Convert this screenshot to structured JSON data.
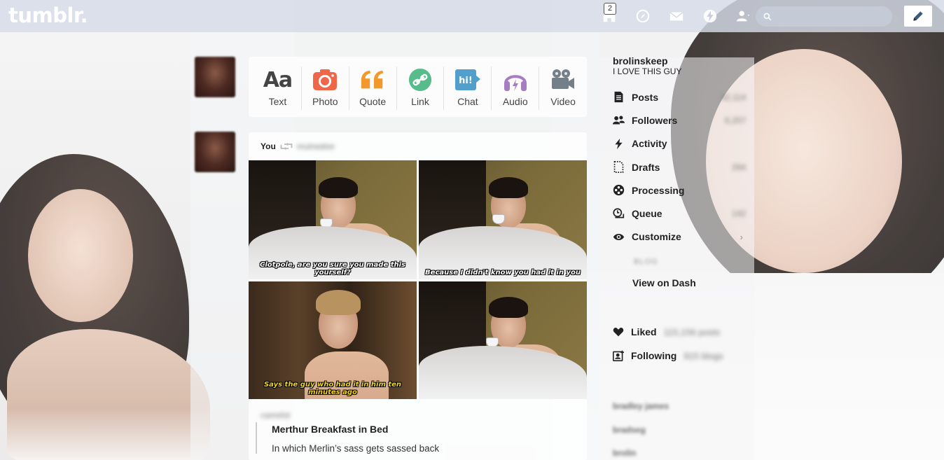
{
  "topbar": {
    "logo": "tumblr.",
    "inbox_badge": "2",
    "search_placeholder": "",
    "icons": [
      "home-icon",
      "compass-icon",
      "mail-icon",
      "lightning-icon",
      "account-icon",
      "search-icon",
      "pencil-icon"
    ]
  },
  "post_types": [
    {
      "label": "Text",
      "icon": "text-icon",
      "color": "#444444"
    },
    {
      "label": "Photo",
      "icon": "camera-icon",
      "color": "#f06649"
    },
    {
      "label": "Quote",
      "icon": "quote-icon",
      "color": "#f2992e"
    },
    {
      "label": "Link",
      "icon": "link-icon",
      "color": "#56bc8a"
    },
    {
      "label": "Chat",
      "icon": "chat-icon",
      "color": "#529ecc"
    },
    {
      "label": "Audio",
      "icon": "headphones-icon",
      "color": "#a77dc2"
    },
    {
      "label": "Video",
      "icon": "video-icon",
      "color": "#748089"
    }
  ],
  "post": {
    "you_label": "You",
    "reblogged_from": "muirwalse",
    "captions": [
      "Clotpole, are you sure you made this yourself?",
      "Because I didn't know you had it in you",
      "Says the guy who had it in him ten minutes ago",
      ""
    ],
    "source_name": "camelot",
    "title": "Merthur Breakfast in Bed",
    "description": "In which Merlin’s sass gets sassed back"
  },
  "sidebar": {
    "blog_name": "brolinskeep",
    "blog_description": "I LOVE THIS GUY",
    "menu": [
      {
        "label": "Posts",
        "icon": "document-icon",
        "count": "42,114"
      },
      {
        "label": "Followers",
        "icon": "people-icon",
        "count": "6,207"
      },
      {
        "label": "Activity",
        "icon": "lightning-icon",
        "count": ""
      },
      {
        "label": "Drafts",
        "icon": "drafts-icon",
        "count": "294"
      },
      {
        "label": "Processing",
        "icon": "processing-icon",
        "count": ""
      },
      {
        "label": "Queue",
        "icon": "queue-icon",
        "count": "142"
      },
      {
        "label": "Customize",
        "icon": "eye-icon",
        "count": ""
      }
    ],
    "blog_label": "BLOG",
    "view_on_dash": "View on Dash",
    "liked_label": "Liked",
    "liked_count": "115,156 posts",
    "following_label": "Following",
    "following_count": "915 blogs",
    "recent_blogs": [
      "bradley james",
      "bradseg",
      "brolin"
    ]
  },
  "colors": {
    "topbar": "#d6dce8",
    "text": "#222222"
  }
}
